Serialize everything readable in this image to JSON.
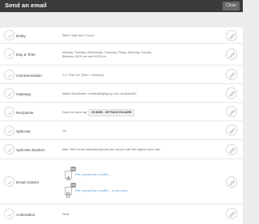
{
  "header": {
    "title": "Send an email",
    "close_label": "Close"
  },
  "rows": [
    {
      "label": "Delay",
      "lines": [
        "Wait 0 days and 1 hours"
      ]
    },
    {
      "label": "Day & Time",
      "lines": [
        "Monday, Tuesday, Wednesday, Thursday, Friday, Saturday, Sunday",
        "Between 09:00 am and 09:00 pm"
      ]
    },
    {
      "label": "Communication",
      "lines": [
        "T-2 • Part 027 (Part I: Infosima)"
      ]
    },
    {
      "label": "Gateway",
      "lines": [
        "Martin Stoobbelier <martin@bgfbgcup.com via Mandrill>"
      ]
    },
    {
      "label": "Recipients",
      "prefix": "Does not have tag",
      "tag": "VS MVB - VIP PASS HOLDER"
    },
    {
      "label": "Split test",
      "lines": [
        "On"
      ]
    },
    {
      "label": "Split test duration",
      "lines": [
        "After 2000 sends automatically pick the version with the highest open ratio"
      ]
    },
    {
      "label": "Email content",
      "emails": [
        {
          "badge": "50%",
          "link": "Phil_named the a coffee..."
        },
        {
          "badge": "50%",
          "link": "Phil_named the a coffee... to the inbox"
        }
      ]
    },
    {
      "label": "Automation",
      "lines": [
        "None"
      ]
    }
  ]
}
